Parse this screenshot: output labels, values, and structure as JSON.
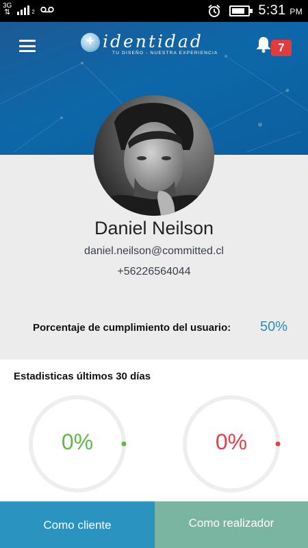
{
  "status_bar": {
    "network": "3G",
    "sim_slot": "2",
    "time": "5:31",
    "ampm": "PM",
    "icons": [
      "signal-icon",
      "voicemail-icon",
      "alarm-icon",
      "battery-icon"
    ]
  },
  "header": {
    "logo_word": "identidad",
    "logo_tagline": "TU DISEÑO - NUESTRA EXPERIENCIA",
    "notification_count": "7",
    "colors": {
      "primary": "#0d67a8",
      "badge": "#e4393d"
    }
  },
  "profile": {
    "name": "Daniel Neilson",
    "email": "daniel.neilson@committed.cl",
    "phone": "+56226564044"
  },
  "compliance": {
    "label": "Porcentaje de cumplimiento del usuario:",
    "value": "50%",
    "color": "#2b8cb0"
  },
  "stats": {
    "title": "Estadisticas últimos 30 días",
    "client_ring": {
      "value": "0%",
      "progress": 0,
      "color": "#5fba45"
    },
    "maker_ring": {
      "value": "0%",
      "progress": 0,
      "color": "#e0414c"
    }
  },
  "tabs": {
    "client": "Como cliente",
    "maker": "Como realizador",
    "client_color": "#2b93c0",
    "maker_color": "#7ab5a2"
  }
}
